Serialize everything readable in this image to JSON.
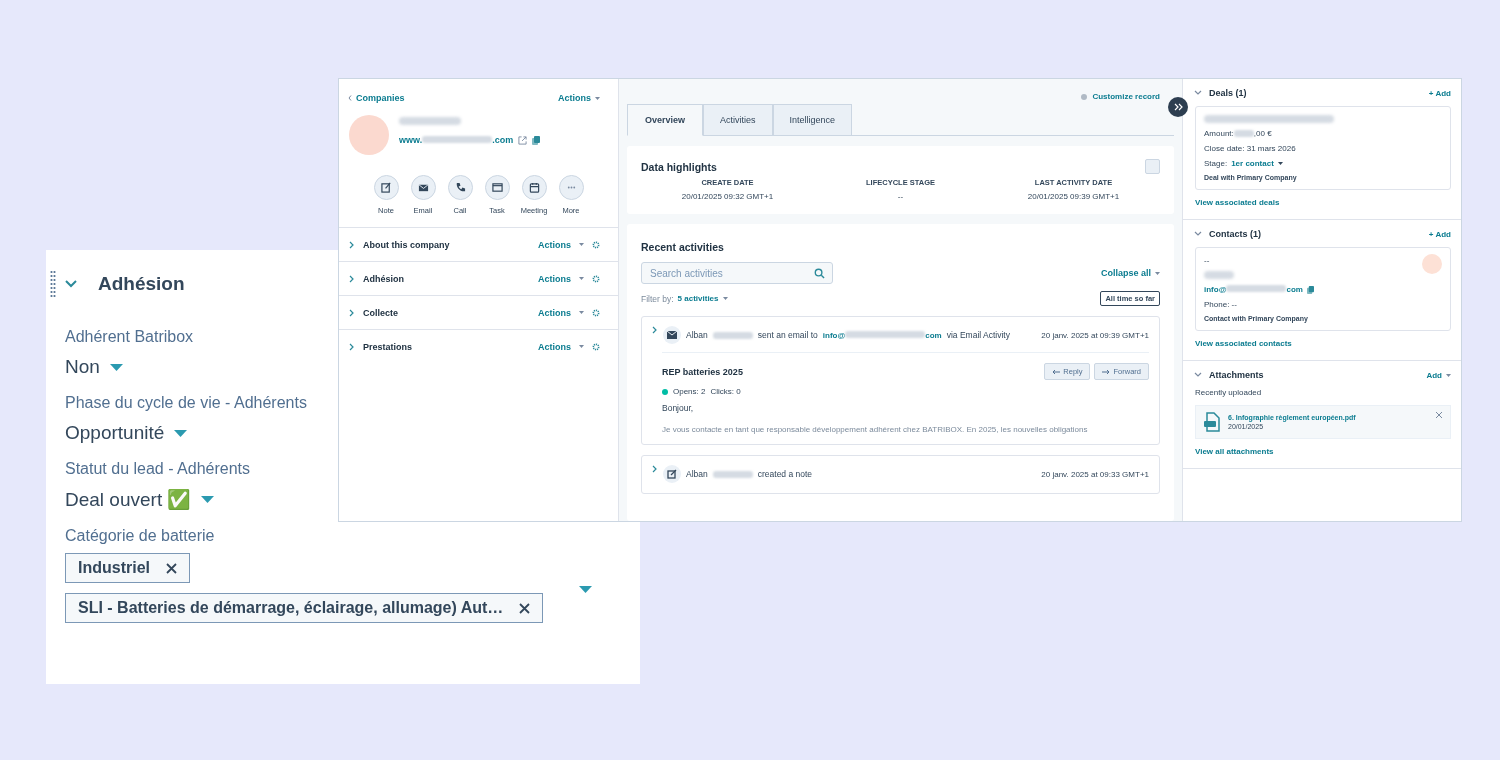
{
  "record": {
    "back_link": "Companies",
    "actions": "Actions",
    "website_prefix": "www.",
    "website_suffix": ".com",
    "quick_actions": [
      {
        "label": "Note",
        "kind": "note"
      },
      {
        "label": "Email",
        "kind": "email"
      },
      {
        "label": "Call",
        "kind": "call"
      },
      {
        "label": "Task",
        "kind": "task"
      },
      {
        "label": "Meeting",
        "kind": "meeting"
      },
      {
        "label": "More",
        "kind": "more"
      }
    ],
    "sections": [
      {
        "title": "About this company",
        "actions": "Actions",
        "expanded": false
      },
      {
        "title": "Adhésion",
        "actions": "Actions",
        "expanded": false
      },
      {
        "title": "Collecte",
        "actions": "Actions",
        "expanded": false
      },
      {
        "title": "Prestations",
        "actions": "Actions",
        "expanded": false
      }
    ]
  },
  "main": {
    "customize": "Customize record",
    "tabs": [
      {
        "label": "Overview",
        "selected": true
      },
      {
        "label": "Activities",
        "selected": false
      },
      {
        "label": "Intelligence",
        "selected": false
      }
    ],
    "highlights": {
      "title": "Data highlights",
      "fields": [
        {
          "label": "CREATE DATE",
          "value": "20/01/2025 09:32 GMT+1"
        },
        {
          "label": "LIFECYCLE STAGE",
          "value": "--"
        },
        {
          "label": "LAST ACTIVITY DATE",
          "value": "20/01/2025 09:39 GMT+1"
        }
      ]
    },
    "activities": {
      "title": "Recent activities",
      "search": {
        "placeholder": "Search activities"
      },
      "collapse": "Collapse all",
      "filter_label": "Filter by:",
      "filter_value": "5 activities",
      "range": "All time so far",
      "items": [
        {
          "kind": "email",
          "actor": "Alban",
          "text": "sent an email to",
          "link_prefix": "info@",
          "link_suffix": "com",
          "tail": "via Email Activity",
          "time": "20 janv. 2025 at 09:39 GMT+1",
          "subject": "REP batteries 2025",
          "reply": "Reply",
          "forward": "Forward",
          "opens": "Opens: 2",
          "clicks": "Clicks: 0",
          "greeting": "Bonjour,",
          "preview": "Je vous contacte en tant que responsable développement adhérent chez BATRIBOX. En 2025, les nouvelles obligations"
        },
        {
          "kind": "note",
          "actor": "Alban",
          "text": "created a note",
          "time": "20 janv. 2025 at 09:33 GMT+1"
        }
      ]
    }
  },
  "sidebar": {
    "deals": {
      "title": "Deals (1)",
      "add": "+ Add",
      "expanded": true,
      "amount_label": "Amount:",
      "amount_suffix": ",00 €",
      "close_date": "Close date: 31 mars 2026",
      "stage_label": "Stage:",
      "stage": "1er contact",
      "association": "Deal with Primary Company",
      "view": "View associated deals"
    },
    "contacts": {
      "title": "Contacts (1)",
      "add": "+ Add",
      "expanded": true,
      "name": "--",
      "email_prefix": "info@",
      "email_suffix": "com",
      "phone": "Phone: --",
      "association": "Contact with Primary Company",
      "view": "View associated contacts"
    },
    "attachments": {
      "title": "Attachments",
      "add": "Add",
      "expanded": true,
      "recent": "Recently uploaded",
      "file_name": "6. Infographie règlement européen.pdf",
      "file_date": "20/01/2025",
      "view": "View all attachments"
    }
  },
  "inset": {
    "title": "Adhésion",
    "expanded": true,
    "fields": [
      {
        "label": "Adhérent Batribox",
        "kind": "select",
        "value": "Non"
      },
      {
        "label": "Phase du cycle de vie - Adhérents",
        "kind": "select",
        "value": "Opportunité"
      },
      {
        "label": "Statut du lead - Adhérents",
        "kind": "select",
        "value": "Deal ouvert ✅"
      },
      {
        "label": "Catégorie de batterie",
        "kind": "tags",
        "tags": [
          "Industriel",
          "SLI - Batteries de démarrage, éclairage, allumage) Aut…"
        ]
      }
    ]
  }
}
